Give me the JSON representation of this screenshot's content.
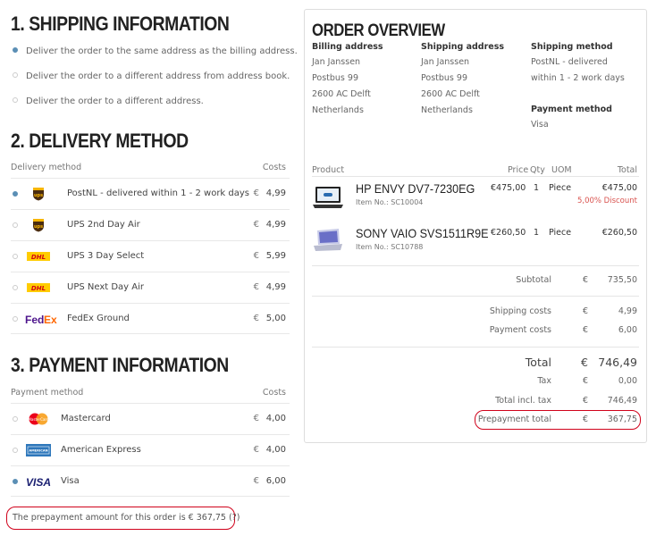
{
  "shipping": {
    "title": "1. SHIPPING INFORMATION",
    "options": [
      "Deliver the order to the same address as the billing address.",
      "Deliver the order to a different address from address book.",
      "Deliver the order to a different address."
    ],
    "selected_index": 0
  },
  "delivery": {
    "title": "2. DELIVERY METHOD",
    "col_method": "Delivery method",
    "col_costs": "Costs",
    "rows": [
      {
        "label": "PostNL - delivered within 1 - 2 work days",
        "currency": "€",
        "amount": "4,99",
        "logo": "ups-logo-icon",
        "selected": true
      },
      {
        "label": "UPS 2nd Day Air",
        "currency": "€",
        "amount": "4,99",
        "logo": "ups-logo-icon",
        "selected": false
      },
      {
        "label": "UPS 3 Day Select",
        "currency": "€",
        "amount": "5,99",
        "logo": "dhl-logo-icon",
        "selected": false
      },
      {
        "label": "UPS Next Day Air",
        "currency": "€",
        "amount": "4,99",
        "logo": "dhl-logo-icon",
        "selected": false
      },
      {
        "label": "FedEx Ground",
        "currency": "€",
        "amount": "5,00",
        "logo": "fedex-logo-icon",
        "selected": false
      }
    ]
  },
  "payment": {
    "title": "3. PAYMENT INFORMATION",
    "col_method": "Payment method",
    "col_costs": "Costs",
    "rows": [
      {
        "label": "Mastercard",
        "currency": "€",
        "amount": "4,00",
        "logo": "mastercard-logo-icon",
        "selected": false
      },
      {
        "label": "American Express",
        "currency": "€",
        "amount": "4,00",
        "logo": "amex-logo-icon",
        "selected": false
      },
      {
        "label": "Visa",
        "currency": "€",
        "amount": "6,00",
        "logo": "visa-logo-icon",
        "selected": true
      }
    ],
    "prepayment_note": "The prepayment amount for this order is € 367,75 (?)"
  },
  "overview": {
    "title": "ORDER OVERVIEW",
    "billing_heading": "Billing address",
    "billing_lines": [
      "Jan Janssen",
      "Postbus 99",
      "2600 AC Delft",
      "Netherlands"
    ],
    "shipping_heading": "Shipping address",
    "shipping_lines": [
      "Jan Janssen",
      "Postbus 99",
      "2600 AC Delft",
      "Netherlands"
    ],
    "method_heading": "Shipping method",
    "method_lines": [
      "PostNL - delivered",
      "within 1 - 2 work days"
    ],
    "payment_heading": "Payment method",
    "payment_value": "Visa",
    "headers": {
      "product": "Product",
      "price": "Price",
      "qty": "Qty",
      "uom": "UOM",
      "total": "Total"
    },
    "products": [
      {
        "name": "HP ENVY DV7-7230EG",
        "item": "Item No.: SC10004",
        "price": "€475,00",
        "qty": "1",
        "uom": "Piece",
        "total": "€475,00",
        "discount": "5,00% Discount"
      },
      {
        "name": "SONY VAIO SVS1511R9E",
        "item": "Item No.: SC10788",
        "price": "€260,50",
        "qty": "1",
        "uom": "Piece",
        "total": "€260,50",
        "discount": ""
      }
    ],
    "subtotal": {
      "label": "Subtotal",
      "cur": "€",
      "value": "735,50"
    },
    "shipping_costs": {
      "label": "Shipping costs",
      "cur": "€",
      "value": "4,99"
    },
    "payment_costs": {
      "label": "Payment costs",
      "cur": "€",
      "value": "6,00"
    },
    "total": {
      "label": "Total",
      "cur": "€",
      "value": "746,49"
    },
    "tax": {
      "label": "Tax",
      "cur": "€",
      "value": "0,00"
    },
    "total_incl": {
      "label": "Total incl. tax",
      "cur": "€",
      "value": "746,49"
    },
    "prepayment": {
      "label": "Prepayment total",
      "cur": "€",
      "value": "367,75"
    }
  }
}
